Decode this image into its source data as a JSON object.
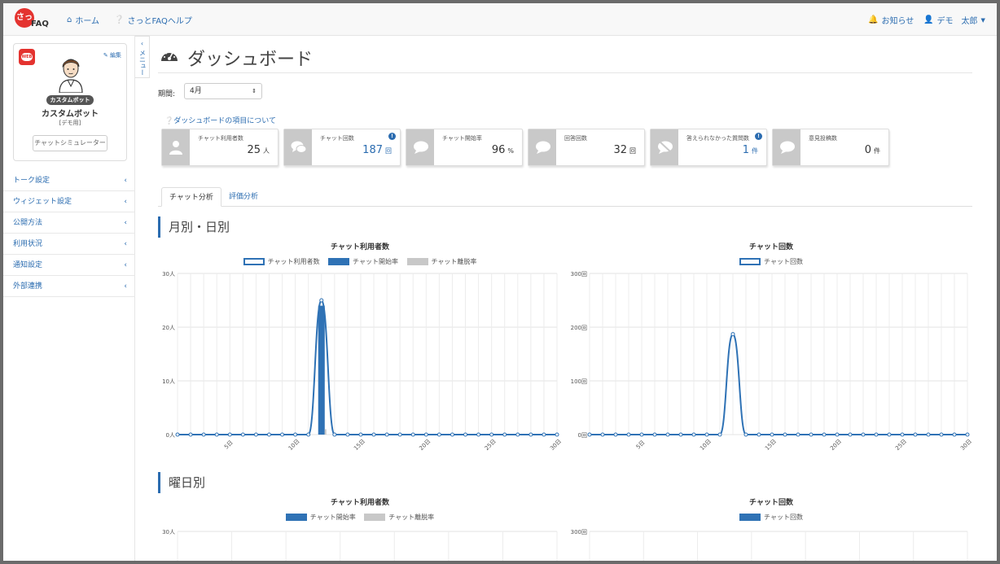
{
  "nav": {
    "logo_mark": "さっ",
    "logo_text": "FAQ",
    "home": "ホーム",
    "help": "さっとFAQヘルプ",
    "notice": "お知らせ",
    "user": "デモ　太郎"
  },
  "sidebar": {
    "edit": "編集",
    "bot_badge": "カスタムボット",
    "bot_name": "カスタムボット",
    "bot_sub": "[デモ用]",
    "simulator": "チャットシミュレーター",
    "toggle": "メニュー",
    "items": [
      {
        "label": "トーク設定"
      },
      {
        "label": "ウィジェット設定"
      },
      {
        "label": "公開方法"
      },
      {
        "label": "利用状況"
      },
      {
        "label": "通知設定"
      },
      {
        "label": "外部連携"
      }
    ]
  },
  "main": {
    "title": "ダッシュボード",
    "period_label": "期間:",
    "period_value": "4月",
    "about_link": "ダッシュボードの項目について",
    "stats": [
      {
        "label": "チャット利用者数",
        "value": "25",
        "unit": "人",
        "info": false,
        "blue": false,
        "icon": "user-icon"
      },
      {
        "label": "チャット回数",
        "value": "187",
        "unit": "回",
        "info": true,
        "blue": true,
        "icon": "chat-bubbles-icon"
      },
      {
        "label": "チャット開始率",
        "value": "96",
        "unit": "%",
        "info": false,
        "blue": false,
        "icon": "chat-bubble-icon"
      },
      {
        "label": "回答回数",
        "value": "32",
        "unit": "回",
        "info": false,
        "blue": false,
        "icon": "answer-bubble-icon"
      },
      {
        "label": "答えられなかった質問数",
        "value": "1",
        "unit": "件",
        "info": true,
        "blue": true,
        "icon": "unanswered-icon"
      },
      {
        "label": "意見投稿数",
        "value": "0",
        "unit": "件",
        "info": false,
        "blue": false,
        "icon": "comment-icon"
      }
    ],
    "tabs": [
      "チャット分析",
      "評価分析"
    ],
    "section1": "月別・日別",
    "section2": "曜日別"
  },
  "colors": {
    "accent": "#2b6cb0",
    "series_blue": "#2f72b5",
    "series_gray": "#c8c8c8",
    "stat_icon_bg": "#c9c9c9",
    "brand_red": "#e4332f"
  },
  "chart_data": [
    {
      "type": "line",
      "title": "チャット利用者数",
      "legend": [
        "チャット利用者数",
        "チャット開始率",
        "チャット離脱率"
      ],
      "x": [
        1,
        2,
        3,
        4,
        5,
        6,
        7,
        8,
        9,
        10,
        11,
        12,
        13,
        14,
        15,
        16,
        17,
        18,
        19,
        20,
        21,
        22,
        23,
        24,
        25,
        26,
        27,
        28,
        29,
        30
      ],
      "x_ticks": [
        "5日",
        "10日",
        "15日",
        "20日",
        "25日",
        "30日"
      ],
      "y_ticks": [
        "0人",
        "10人",
        "20人",
        "30人"
      ],
      "ylim": [
        0,
        30
      ],
      "series": [
        {
          "name": "チャット利用者数",
          "kind": "line",
          "values": [
            0,
            0,
            0,
            0,
            0,
            0,
            0,
            0,
            0,
            0,
            0,
            25,
            0,
            0,
            0,
            0,
            0,
            0,
            0,
            0,
            0,
            0,
            0,
            0,
            0,
            0,
            0,
            0,
            0,
            0
          ]
        },
        {
          "name": "チャット開始率",
          "kind": "bar",
          "values": [
            0,
            0,
            0,
            0,
            0,
            0,
            0,
            0,
            0,
            0,
            0,
            24,
            0,
            0,
            0,
            0,
            0,
            0,
            0,
            0,
            0,
            0,
            0,
            0,
            0,
            0,
            0,
            0,
            0,
            0
          ]
        },
        {
          "name": "チャット離脱率",
          "kind": "bar",
          "values": [
            0,
            0,
            0,
            0,
            0,
            0,
            0,
            0,
            0,
            0,
            0,
            1,
            0,
            0,
            0,
            0,
            0,
            0,
            0,
            0,
            0,
            0,
            0,
            0,
            0,
            0,
            0,
            0,
            0,
            0
          ]
        }
      ]
    },
    {
      "type": "line",
      "title": "チャット回数",
      "legend": [
        "チャット回数"
      ],
      "x": [
        1,
        2,
        3,
        4,
        5,
        6,
        7,
        8,
        9,
        10,
        11,
        12,
        13,
        14,
        15,
        16,
        17,
        18,
        19,
        20,
        21,
        22,
        23,
        24,
        25,
        26,
        27,
        28,
        29,
        30
      ],
      "x_ticks": [
        "5日",
        "10日",
        "15日",
        "20日",
        "25日",
        "30日"
      ],
      "y_ticks": [
        "0回",
        "100回",
        "200回",
        "300回"
      ],
      "ylim": [
        0,
        300
      ],
      "series": [
        {
          "name": "チャット回数",
          "kind": "line",
          "values": [
            0,
            0,
            0,
            0,
            0,
            0,
            0,
            0,
            0,
            0,
            0,
            187,
            0,
            0,
            0,
            0,
            0,
            0,
            0,
            0,
            0,
            0,
            0,
            0,
            0,
            0,
            0,
            0,
            0,
            0
          ]
        }
      ]
    },
    {
      "type": "bar",
      "title": "チャット利用者数",
      "legend": [
        "チャット開始率",
        "チャット離脱率"
      ],
      "y_ticks": [
        "30人"
      ]
    },
    {
      "type": "bar",
      "title": "チャット回数",
      "legend": [
        "チャット回数"
      ],
      "y_ticks": [
        "300回"
      ]
    }
  ]
}
